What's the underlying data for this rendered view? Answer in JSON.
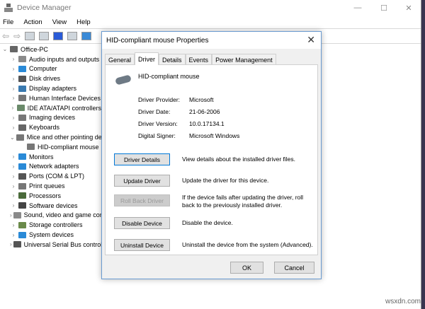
{
  "window": {
    "title": "Device Manager",
    "controls": [
      "—",
      "☐",
      "✕"
    ]
  },
  "menu": [
    "File",
    "Action",
    "View",
    "Help"
  ],
  "tree": {
    "root": "Office-PC",
    "items": [
      {
        "label": "Audio inputs and outputs",
        "color": "#8a8a8a"
      },
      {
        "label": "Computer",
        "color": "#2a8ad7"
      },
      {
        "label": "Disk drives",
        "color": "#555555"
      },
      {
        "label": "Display adapters",
        "color": "#3a7ab0"
      },
      {
        "label": "Human Interface Devices",
        "color": "#777777"
      },
      {
        "label": "IDE ATA/ATAPI controllers",
        "color": "#6a8a6a"
      },
      {
        "label": "Imaging devices",
        "color": "#777777"
      },
      {
        "label": "Keyboards",
        "color": "#666666"
      },
      {
        "label": "Mice and other pointing devices",
        "color": "#777777",
        "expanded": true
      },
      {
        "label": "HID-compliant mouse",
        "color": "#777777",
        "child": true
      },
      {
        "label": "Monitors",
        "color": "#2a8ad7"
      },
      {
        "label": "Network adapters",
        "color": "#2a8ad7"
      },
      {
        "label": "Ports (COM & LPT)",
        "color": "#555555"
      },
      {
        "label": "Print queues",
        "color": "#777777"
      },
      {
        "label": "Processors",
        "color": "#4a6a3a"
      },
      {
        "label": "Software devices",
        "color": "#444444"
      },
      {
        "label": "Sound, video and game controllers",
        "color": "#8a8a8a"
      },
      {
        "label": "Storage controllers",
        "color": "#6a8a4a"
      },
      {
        "label": "System devices",
        "color": "#2a8ad7"
      },
      {
        "label": "Universal Serial Bus controllers",
        "color": "#555555"
      }
    ]
  },
  "dialog": {
    "title": "HID-compliant mouse Properties",
    "tabs": [
      "General",
      "Driver",
      "Details",
      "Events",
      "Power Management"
    ],
    "active_tab": "Driver",
    "device_name": "HID-compliant mouse",
    "fields": [
      {
        "k": "Driver Provider:",
        "v": "Microsoft"
      },
      {
        "k": "Driver Date:",
        "v": "21-06-2006"
      },
      {
        "k": "Driver Version:",
        "v": "10.0.17134.1"
      },
      {
        "k": "Digital Signer:",
        "v": "Microsoft Windows"
      }
    ],
    "actions": [
      {
        "label": "Driver Details",
        "desc": "View details about the installed driver files."
      },
      {
        "label": "Update Driver",
        "desc": "Update the driver for this device."
      },
      {
        "label": "Roll Back Driver",
        "desc": "If the device fails after updating the driver, roll back to the previously installed driver.",
        "disabled": true
      },
      {
        "label": "Disable Device",
        "desc": "Disable the device."
      },
      {
        "label": "Uninstall Device",
        "desc": "Uninstall the device from the system (Advanced)."
      }
    ],
    "ok": "OK",
    "cancel": "Cancel"
  },
  "watermark": "wsxdn.com"
}
